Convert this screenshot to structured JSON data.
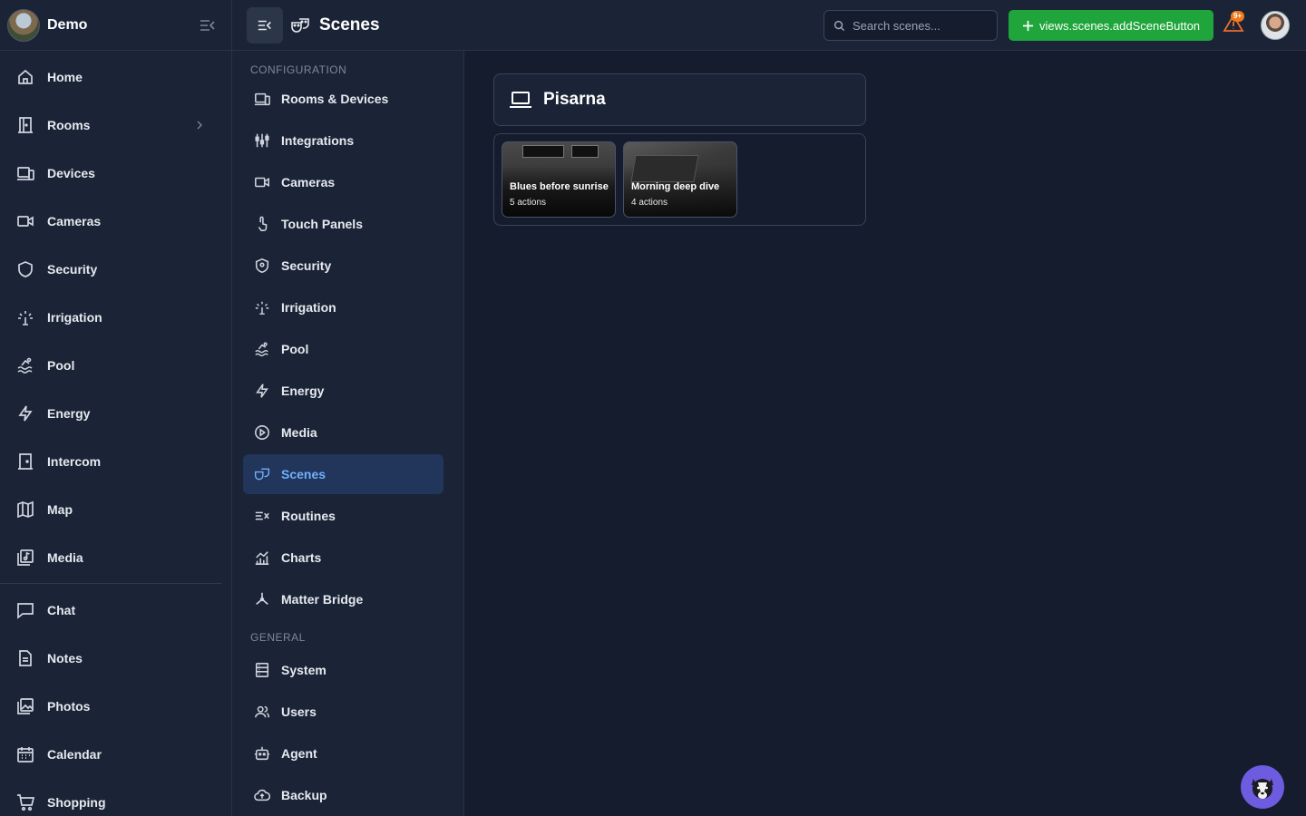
{
  "app": {
    "name": "Demo"
  },
  "sidebar": {
    "items": [
      {
        "label": "Home",
        "icon": "home-icon"
      },
      {
        "label": "Rooms",
        "icon": "door-icon"
      },
      {
        "label": "Devices",
        "icon": "devices-icon"
      },
      {
        "label": "Cameras",
        "icon": "camera-icon"
      },
      {
        "label": "Security",
        "icon": "shield-icon"
      },
      {
        "label": "Irrigation",
        "icon": "sprinkler-icon"
      },
      {
        "label": "Pool",
        "icon": "pool-icon"
      },
      {
        "label": "Energy",
        "icon": "bolt-icon"
      },
      {
        "label": "Intercom",
        "icon": "intercom-icon"
      },
      {
        "label": "Map",
        "icon": "map-icon"
      },
      {
        "label": "Media",
        "icon": "media-icon"
      }
    ],
    "items2": [
      {
        "label": "Chat",
        "icon": "chat-icon"
      },
      {
        "label": "Notes",
        "icon": "notes-icon"
      },
      {
        "label": "Photos",
        "icon": "photos-icon"
      },
      {
        "label": "Calendar",
        "icon": "calendar-icon"
      },
      {
        "label": "Shopping",
        "icon": "cart-icon"
      }
    ]
  },
  "header": {
    "title": "Scenes",
    "search_placeholder": "Search scenes...",
    "add_button": "views.scenes.addSceneButton",
    "alert_badge": "9+"
  },
  "config": {
    "section1": "CONFIGURATION",
    "items": [
      {
        "label": "Rooms & Devices",
        "icon": "rooms-devices-icon"
      },
      {
        "label": "Integrations",
        "icon": "integrations-icon"
      },
      {
        "label": "Cameras",
        "icon": "camera-icon"
      },
      {
        "label": "Touch Panels",
        "icon": "touch-icon"
      },
      {
        "label": "Security",
        "icon": "shield-icon"
      },
      {
        "label": "Irrigation",
        "icon": "sprinkler-icon"
      },
      {
        "label": "Pool",
        "icon": "pool-icon"
      },
      {
        "label": "Energy",
        "icon": "bolt-icon"
      },
      {
        "label": "Media",
        "icon": "play-icon"
      },
      {
        "label": "Scenes",
        "icon": "scenes-icon",
        "active": true
      },
      {
        "label": "Routines",
        "icon": "routines-icon"
      },
      {
        "label": "Charts",
        "icon": "chart-icon"
      },
      {
        "label": "Matter Bridge",
        "icon": "matter-icon"
      }
    ],
    "section2": "GENERAL",
    "items2": [
      {
        "label": "System",
        "icon": "system-icon"
      },
      {
        "label": "Users",
        "icon": "users-icon"
      },
      {
        "label": "Agent",
        "icon": "agent-icon"
      },
      {
        "label": "Backup",
        "icon": "backup-icon"
      }
    ]
  },
  "main": {
    "room": {
      "name": "Pisarna",
      "icon": "laptop-icon"
    },
    "scenes": [
      {
        "name": "Blues before sunrise",
        "actions": "5 actions"
      },
      {
        "name": "Morning deep dive",
        "actions": "4 actions"
      }
    ]
  },
  "colors": {
    "accent": "#1fa53c",
    "active": "#6fb0ff",
    "alert": "#ef6b2b"
  }
}
